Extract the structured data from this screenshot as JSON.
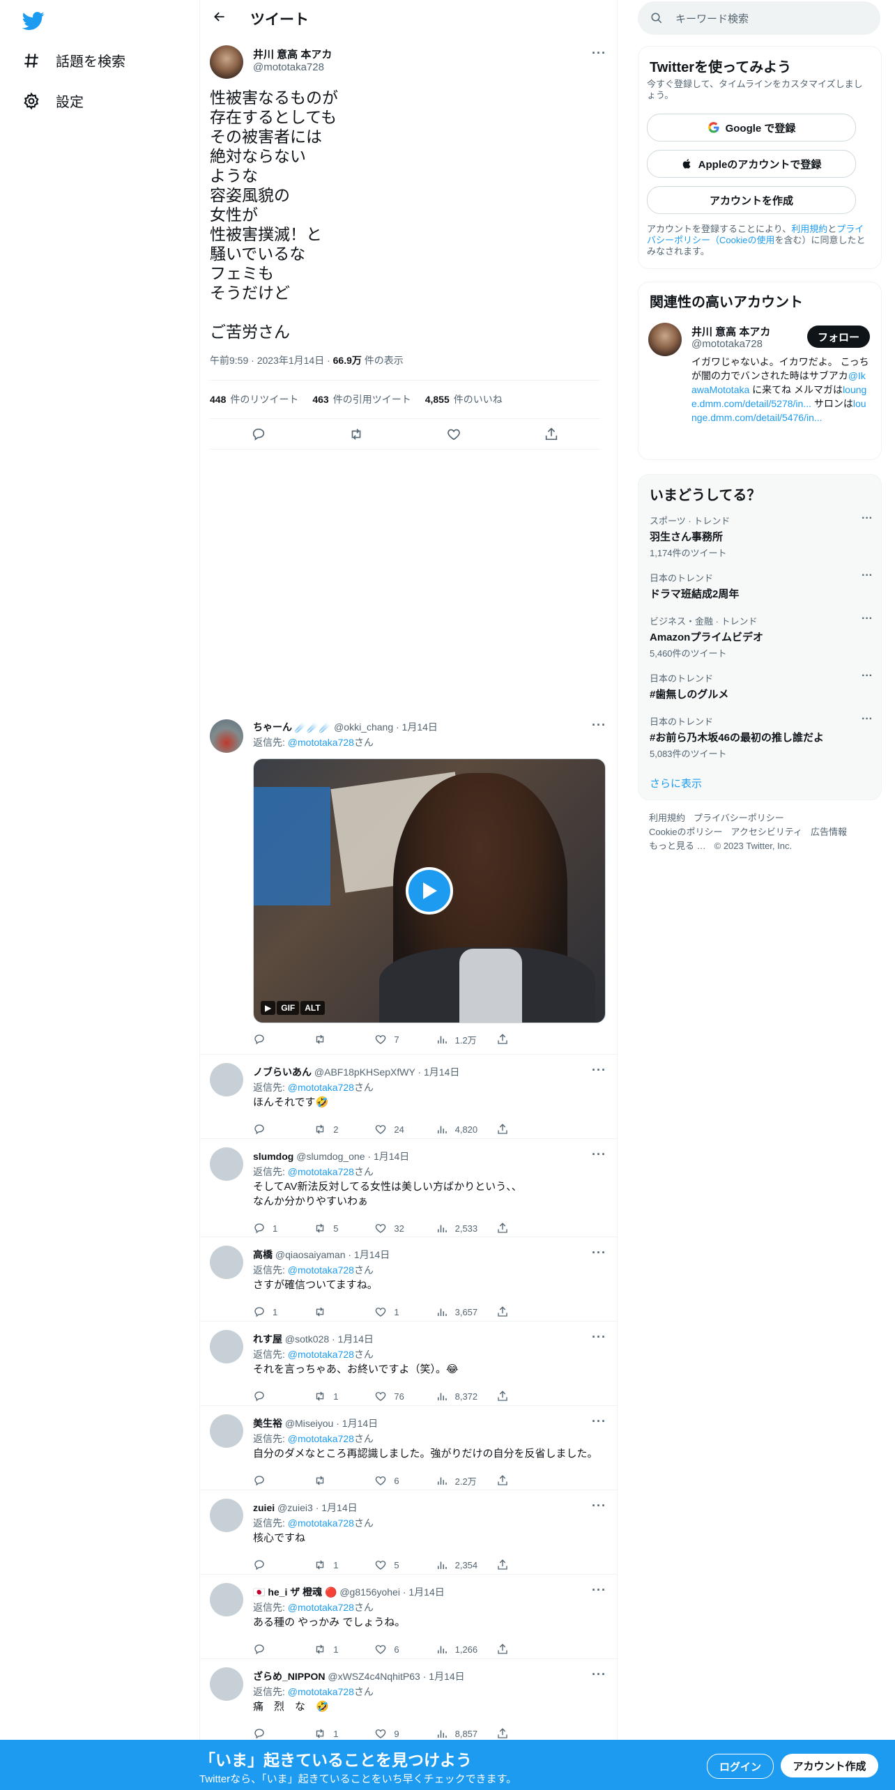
{
  "nav": {
    "explore": "話題を検索",
    "settings": "設定"
  },
  "header": {
    "title": "ツイート"
  },
  "main_tweet": {
    "name": "井川 意高 本アカ",
    "handle": "@mototaka728",
    "text": "性被害なるものが\n存在するとしても\nその被害者には\n絶対ならない\nような\n容姿風貌の\n女性が\n性被害撲滅！と\n騒いでいるな\nフェミも\nそうだけど\n\nご苦労さん",
    "time": "午前9:59 · 2023年1月14日 · ",
    "views_num": "66.9万",
    "views_label": " 件の表示",
    "retweets_num": "448",
    "retweets_label": "件のリツイート",
    "quotes_num": "463",
    "quotes_label": "件の引用ツイート",
    "likes_num": "4,855",
    "likes_label": "件のいいね"
  },
  "reply_prefix": "返信先: ",
  "reply_to": "@mototaka728",
  "reply_suffix": "さん",
  "video_badges": [
    "GIF",
    "ALT"
  ],
  "replies": [
    {
      "name": "ちゃーん",
      "meta": " ☄️☄️☄️ @okki_chang · 1月14日",
      "text": "",
      "counts": {
        "reply": "",
        "retweet": "",
        "like": "7",
        "views": "1.2万"
      }
    },
    {
      "name": "ノブらいあん",
      "meta": " @ABF18pKHSepXfWY · 1月14日",
      "text": "ほんそれです🤣",
      "counts": {
        "reply": "",
        "retweet": "2",
        "like": "24",
        "views": "4,820"
      }
    },
    {
      "name": "slumdog",
      "meta": " @slumdog_one · 1月14日",
      "text": "そしてAV新法反対してる女性は美しい方ばかりという、、\nなんか分かりやすいわぁ",
      "counts": {
        "reply": "1",
        "retweet": "5",
        "like": "32",
        "views": "2,533"
      }
    },
    {
      "name": "高橋",
      "meta": " @qiaosaiyaman · 1月14日",
      "text": "さすが確信ついてますね。",
      "counts": {
        "reply": "1",
        "retweet": "",
        "like": "1",
        "views": "3,657"
      }
    },
    {
      "name": "れす屋",
      "meta": " @sotk028 · 1月14日",
      "text": "それを言っちゃあ、お終いですよ（笑）。😂",
      "counts": {
        "reply": "",
        "retweet": "1",
        "like": "76",
        "views": "8,372"
      }
    },
    {
      "name": "美生裕",
      "meta": " @Miseiyou · 1月14日",
      "text": "自分のダメなところ再認識しました。強がりだけの自分を反省しました。",
      "counts": {
        "reply": "",
        "retweet": "",
        "like": "6",
        "views": "2.2万"
      }
    },
    {
      "name": "zuiei",
      "meta": " @zuiei3 · 1月14日",
      "text": "核心ですね",
      "counts": {
        "reply": "",
        "retweet": "1",
        "like": "5",
        "views": "2,354"
      }
    },
    {
      "name": "🇯🇵 he_i ザ 橙魂 🔴",
      "meta": " @g8156yohei · 1月14日",
      "text": "ある種の やっかみ でしょうね。",
      "counts": {
        "reply": "",
        "retweet": "1",
        "like": "6",
        "views": "1,266"
      }
    },
    {
      "name": "ざらめ_NIPPON",
      "meta": " @xWSZ4c4NqhitP63 · 1月14日",
      "text": "痛　烈　な　🤣",
      "counts": {
        "reply": "",
        "retweet": "1",
        "like": "9",
        "views": "8,857"
      }
    }
  ],
  "sidebar": {
    "search_placeholder": "キーワード検索",
    "signup_title": "Twitterを使ってみよう",
    "signup_sub": "今すぐ登録して、タイムラインをカスタマイズしましょう。",
    "google_btn": "Google で登録",
    "apple_btn": "Appleのアカウントで登録",
    "create_btn": "アカウントを作成",
    "terms_pre": "アカウントを登録することにより、",
    "terms_link": "利用規約",
    "terms_and": "と",
    "privacy_link": "プライバシーポリシー",
    "terms_paren_open": "（",
    "cookie_link": "Cookieの使用",
    "terms_post": "を含む）に同意したとみなされます。",
    "related_title": "関連性の高いアカウント",
    "related_name": "井川 意高 本アカ",
    "related_handle": "@mototaka728",
    "follow_btn": "フォロー",
    "bio_1": "イガワじゃないよ。イカワだよ。 こっちが闇の力でバンされた時はサブアカ",
    "bio_link1": "@IkawaMototaka",
    "bio_2": " に来てね メルマガは",
    "bio_link2": "lounge.dmm.com/detail/5278/in...",
    "bio_3": " サロンは",
    "bio_link3": "lounge.dmm.com/detail/5476/in...",
    "trends_title": "いまどうしてる？",
    "trends": [
      {
        "cat": "スポーツ · トレンド",
        "name": "羽生さん事務所",
        "count": "1,174件のツイート"
      },
      {
        "cat": "日本のトレンド",
        "name": "ドラマ班結成2周年",
        "count": ""
      },
      {
        "cat": "ビジネス・金融 · トレンド",
        "name": "Amazonプライムビデオ",
        "count": "5,460件のツイート"
      },
      {
        "cat": "日本のトレンド",
        "name": "#歯無しのグルメ",
        "count": ""
      },
      {
        "cat": "日本のトレンド",
        "name": "#お前ら乃木坂46の最初の推し誰だよ",
        "count": "5,083件のツイート"
      }
    ],
    "show_more": "さらに表示",
    "footer": [
      "利用規約",
      "プライバシーポリシー",
      "Cookieのポリシー",
      "アクセシビリティ",
      "広告情報",
      "もっと見る …",
      "© 2023 Twitter, Inc."
    ]
  },
  "bottom": {
    "title": "「いま」起きていることを見つけよう",
    "sub": "Twitterなら、「いま」起きていることをいち早くチェックできます。",
    "login": "ログイン",
    "signup": "アカウント作成"
  },
  "colors": {
    "accent": "#1d9bf0",
    "text": "#0f1419",
    "muted": "#536471"
  }
}
